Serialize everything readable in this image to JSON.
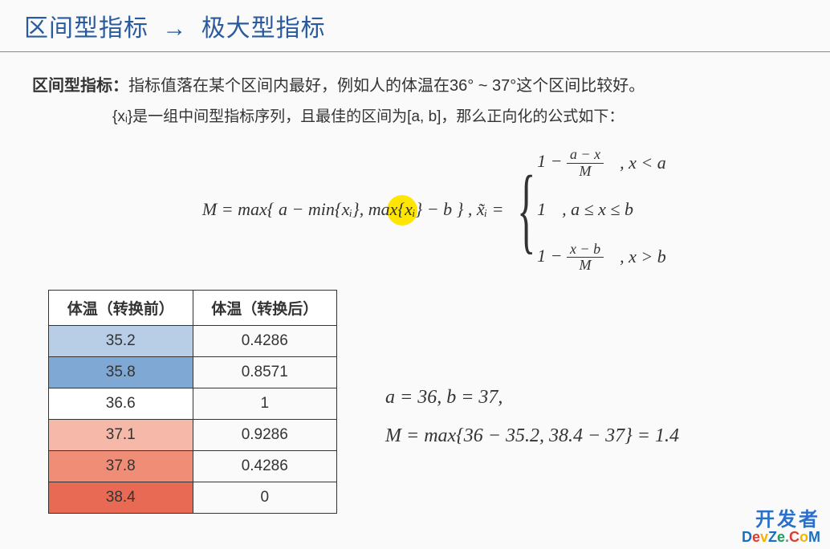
{
  "title": {
    "from": "区间型指标",
    "arrow": "→",
    "to": "极大型指标"
  },
  "def_label": "区间型指标：",
  "def_text": "指标值落在某个区间内最好，例如人的体温在36° ~ 37°这个区间比较好。",
  "sub_text": "{xᵢ}是一组中间型指标序列，且最佳的区间为[a, b]，那么正向化的公式如下：",
  "formula_M": "M  = max{ a − min{xᵢ}, max{xᵢ} − b } ,   x̃ᵢ  =",
  "cases": {
    "c1_expr_prefix": "1 −",
    "c1_num": "a − x",
    "c1_den": "M",
    "c1_cond": ", x < a",
    "c2_expr": "1",
    "c2_cond": ", a ≤ x ≤ b",
    "c3_expr_prefix": "1 −",
    "c3_num": "x − b",
    "c3_den": "M",
    "c3_cond": ", x > b"
  },
  "table": {
    "h1": "体温（转换前）",
    "h2": "体温（转换后）",
    "rows": [
      {
        "a": "35.2",
        "b": "0.4286",
        "cls": "row-b1"
      },
      {
        "a": "35.8",
        "b": "0.8571",
        "cls": "row-b2"
      },
      {
        "a": "36.6",
        "b": "1",
        "cls": "row-w"
      },
      {
        "a": "37.1",
        "b": "0.9286",
        "cls": "row-r1"
      },
      {
        "a": "37.8",
        "b": "0.4286",
        "cls": "row-r2"
      },
      {
        "a": "38.4",
        "b": "0",
        "cls": "row-r3"
      }
    ]
  },
  "example_line1": "a  =  36,  b  = 37,",
  "example_line2": "M =  max{36 − 35.2,  38.4 − 37} = 1.4",
  "watermark_cn": "开发者",
  "watermark_en": [
    "D",
    "e",
    "v",
    "Z",
    "e",
    ".",
    "C",
    "o",
    "M"
  ]
}
